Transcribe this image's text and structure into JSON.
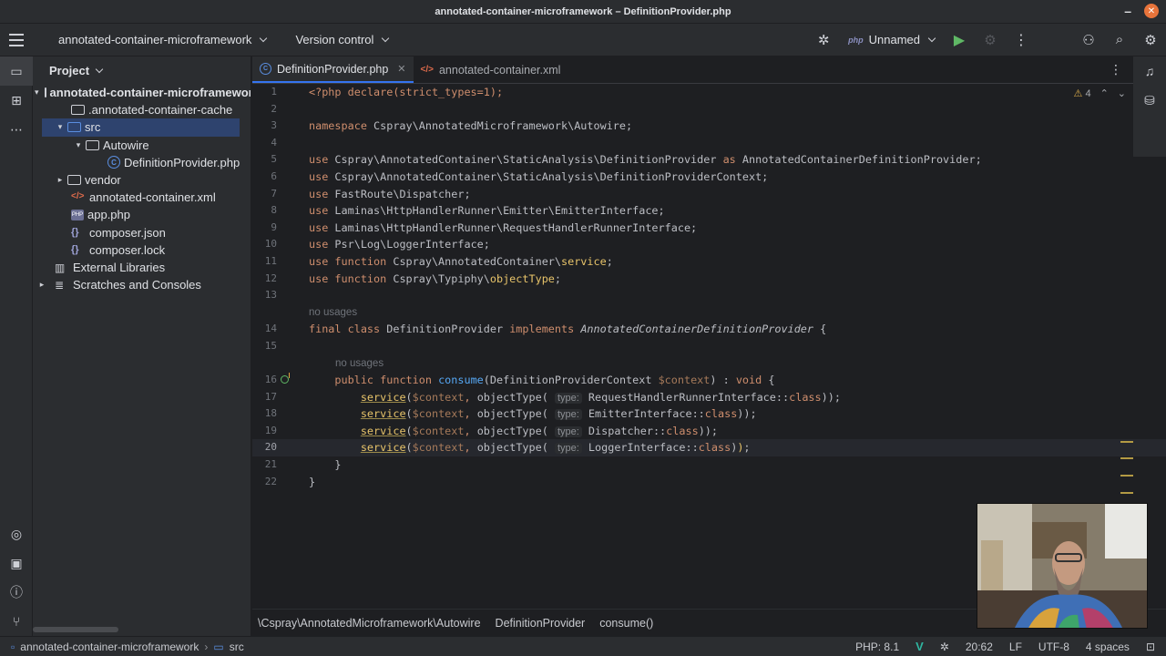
{
  "window": {
    "title": "annotated-container-microframework – DefinitionProvider.php"
  },
  "toolbar": {
    "project_name": "annotated-container-microframework",
    "vcs_label": "Version control",
    "run_config": "Unnamed",
    "php_badge": "php"
  },
  "project_panel": {
    "title": "Project",
    "tree": [
      {
        "label": "annotated-container-microframework",
        "icon": "folder-icon",
        "depth": 0,
        "arrow": "▾"
      },
      {
        "label": ".annotated-container-cache",
        "icon": "folder-icon",
        "depth": 1,
        "arrow": ""
      },
      {
        "label": "src",
        "icon": "folder-icon",
        "depth": 1,
        "arrow": "▾"
      },
      {
        "label": "Autowire",
        "icon": "folder-icon",
        "depth": 2,
        "arrow": "▾"
      },
      {
        "label": "DefinitionProvider.php",
        "icon": "php-class-icon",
        "depth": 3,
        "arrow": ""
      },
      {
        "label": "vendor",
        "icon": "folder-icon",
        "depth": 1,
        "arrow": "▸"
      },
      {
        "label": "annotated-container.xml",
        "icon": "xml-file-icon",
        "depth": 1,
        "arrow": ""
      },
      {
        "label": "app.php",
        "icon": "php-file-icon",
        "depth": 1,
        "arrow": ""
      },
      {
        "label": "composer.json",
        "icon": "json-file-icon",
        "depth": 1,
        "arrow": ""
      },
      {
        "label": "composer.lock",
        "icon": "json-file-icon",
        "depth": 1,
        "arrow": ""
      },
      {
        "label": "External Libraries",
        "icon": "library-icon",
        "depth": 0,
        "arrow": ""
      },
      {
        "label": "Scratches and Consoles",
        "icon": "scratches-icon",
        "depth": 0,
        "arrow": "▸"
      }
    ]
  },
  "tabs": [
    {
      "label": "DefinitionProvider.php",
      "active": true
    },
    {
      "label": "annotated-container.xml",
      "active": false
    }
  ],
  "inspections": {
    "warning_count": "4"
  },
  "code": {
    "no_usages": "no usages",
    "inlay_type": "type:",
    "l1": "<?php declare(strict_types=1);",
    "l3_kw": "namespace",
    "l3": " Cspray\\AnnotatedMicroframework\\Autowire;",
    "l5_kw": "use",
    "l5a": " Cspray\\AnnotatedContainer\\StaticAnalysis\\DefinitionProvider ",
    "l5_as": "as",
    "l5b": " AnnotatedContainerDefinitionProvider;",
    "l6_kw": "use",
    "l6": " Cspray\\AnnotatedContainer\\StaticAnalysis\\DefinitionProviderContext;",
    "l7_kw": "use",
    "l7": " FastRoute\\Dispatcher;",
    "l8_kw": "use",
    "l8": " Laminas\\HttpHandlerRunner\\Emitter\\EmitterInterface;",
    "l9_kw": "use",
    "l9": " Laminas\\HttpHandlerRunner\\RequestHandlerRunnerInterface;",
    "l10_kw": "use",
    "l10": " Psr\\Log\\LoggerInterface;",
    "l11_kw": "use function",
    "l11a": " Cspray\\AnnotatedContainer\\",
    "l11_fn": "service",
    "l11b": ";",
    "l12_kw": "use function",
    "l12a": " Cspray\\Typiphy\\",
    "l12_fn": "objectType",
    "l12b": ";",
    "l14_kw1": "final class",
    "l14_name": " DefinitionProvider ",
    "l14_kw2": "implements",
    "l14_iface": " AnnotatedContainerDefinitionProvider",
    "l14_end": " {",
    "l16_kw": "public function",
    "l16_fn": " consume",
    "l16a": "(DefinitionProviderContext ",
    "l16_var": "$context",
    "l16b": ") : ",
    "l16_void": "void",
    "l16c": " {",
    "svc": "service",
    "ctx": "$context",
    "ot": "objectType",
    "l17_cls": "RequestHandlerRunnerInterface",
    "l18_cls": "EmitterInterface",
    "l19_cls": "Dispatcher",
    "l20_cls": "LoggerInterface",
    "class_kw": "class",
    "l21": "}",
    "l22": "}"
  },
  "breadcrumbs": [
    "\\Cspray\\AnnotatedMicroframework\\Autowire",
    "DefinitionProvider",
    "consume()"
  ],
  "statusbar": {
    "project": "annotated-container-microframework",
    "folder": "src",
    "php_version": "PHP: 8.1",
    "position": "20:62",
    "line_sep": "LF",
    "encoding": "UTF-8",
    "indent": "4 spaces"
  }
}
